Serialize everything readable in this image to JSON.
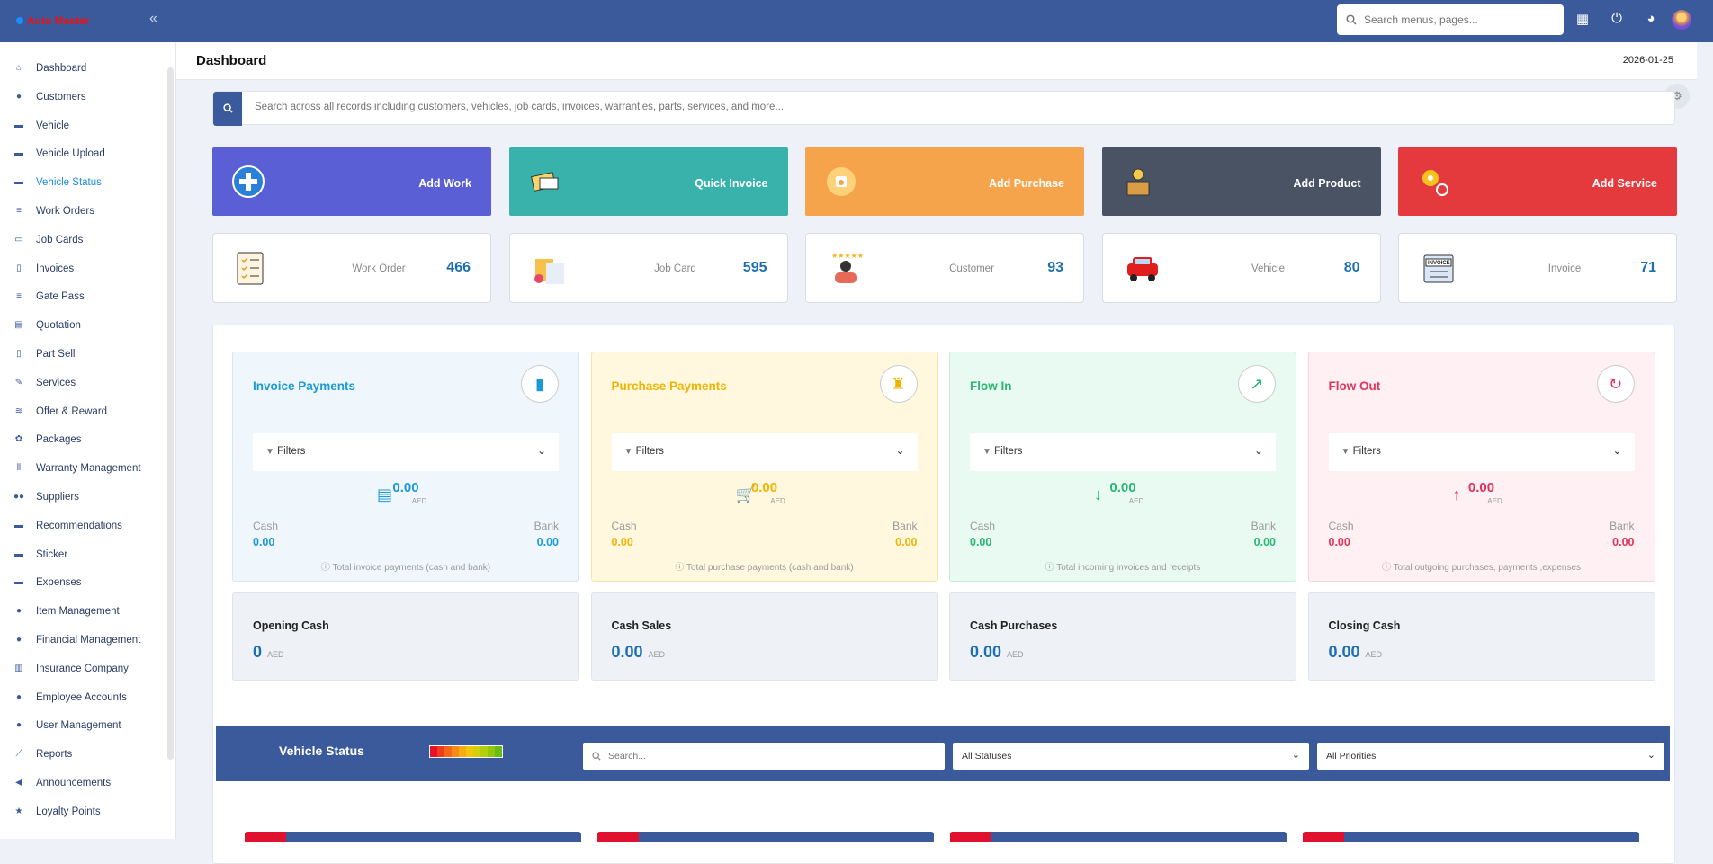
{
  "app": {
    "brand": "Auto Master"
  },
  "topbar": {
    "search_placeholder": "Search menus, pages..."
  },
  "sidebar": {
    "items": [
      {
        "label": "Dashboard",
        "icon": "home-icon"
      },
      {
        "label": "Customers",
        "icon": "user-icon"
      },
      {
        "label": "Vehicle",
        "icon": "car-icon"
      },
      {
        "label": "Vehicle Upload",
        "icon": "truck-icon"
      },
      {
        "label": "Vehicle Status",
        "icon": "car-icon",
        "active": true
      },
      {
        "label": "Work Orders",
        "icon": "list-icon"
      },
      {
        "label": "Job Cards",
        "icon": "card-icon"
      },
      {
        "label": "Invoices",
        "icon": "file-icon"
      },
      {
        "label": "Gate Pass",
        "icon": "list-icon"
      },
      {
        "label": "Quotation",
        "icon": "quote-icon"
      },
      {
        "label": "Part Sell",
        "icon": "bookmark-icon"
      },
      {
        "label": "Services",
        "icon": "wrench-icon"
      },
      {
        "label": "Offer & Reward",
        "icon": "layers-icon"
      },
      {
        "label": "Packages",
        "icon": "package-icon"
      },
      {
        "label": "Warranty Management",
        "icon": "barcode-icon"
      },
      {
        "label": "Suppliers",
        "icon": "users-icon"
      },
      {
        "label": "Recommendations",
        "icon": "box-icon"
      },
      {
        "label": "Sticker",
        "icon": "box-icon"
      },
      {
        "label": "Expenses",
        "icon": "box-icon"
      },
      {
        "label": "Item Management",
        "icon": "user-icon"
      },
      {
        "label": "Financial Management",
        "icon": "user-icon"
      },
      {
        "label": "Insurance Company",
        "icon": "building-icon"
      },
      {
        "label": "Employee Accounts",
        "icon": "user-icon"
      },
      {
        "label": "User Management",
        "icon": "user-icon"
      },
      {
        "label": "Reports",
        "icon": "chart-icon"
      },
      {
        "label": "Announcements",
        "icon": "megaphone-icon"
      },
      {
        "label": "Loyalty Points",
        "icon": "star-icon"
      }
    ]
  },
  "header": {
    "title": "Dashboard",
    "date": "2026-01-25"
  },
  "global_search": {
    "placeholder": "Search across all records including customers, vehicles, job cards, invoices, warranties, parts, services, and more..."
  },
  "actions": [
    {
      "label": "Add Work",
      "color": "#5a5fd6"
    },
    {
      "label": "Quick Invoice",
      "color": "#38b2aa"
    },
    {
      "label": "Add Purchase",
      "color": "#f5a44c"
    },
    {
      "label": "Add Product",
      "color": "#4a5364"
    },
    {
      "label": "Add Service",
      "color": "#e4393d"
    }
  ],
  "stats": [
    {
      "label": "Work Order",
      "value": "466"
    },
    {
      "label": "Job Card",
      "value": "595"
    },
    {
      "label": "Customer",
      "value": "93"
    },
    {
      "label": "Vehicle",
      "value": "80"
    },
    {
      "label": "Invoice",
      "value": "71"
    }
  ],
  "payments": [
    {
      "title": "Invoice Payments",
      "filters": "Filters",
      "amount": "0.00",
      "currency": "AED",
      "cash_label": "Cash",
      "cash": "0.00",
      "bank_label": "Bank",
      "bank": "0.00",
      "note": "Total invoice payments (cash and bank)",
      "color": "#1b9ad6",
      "bg": "#eff7fd",
      "border": "#d3e6f4"
    },
    {
      "title": "Purchase Payments",
      "filters": "Filters",
      "amount": "0.00",
      "currency": "AED",
      "cash_label": "Cash",
      "cash": "0.00",
      "bank_label": "Bank",
      "bank": "0.00",
      "note": "Total purchase payments (cash and bank)",
      "color": "#f0b400",
      "bg": "#fff8df",
      "border": "#f6e4a8"
    },
    {
      "title": "Flow In",
      "filters": "Filters",
      "amount": "0.00",
      "currency": "AED",
      "cash_label": "Cash",
      "cash": "0.00",
      "bank_label": "Bank",
      "bank": "0.00",
      "note": "Total incoming invoices and receipts",
      "color": "#2bb673",
      "bg": "#e9faf2",
      "border": "#c4ecd9"
    },
    {
      "title": "Flow Out",
      "filters": "Filters",
      "amount": "0.00",
      "currency": "AED",
      "cash_label": "Cash",
      "cash": "0.00",
      "bank_label": "Bank",
      "bank": "0.00",
      "note": "Total outgoing purchases, payments ,expenses",
      "color": "#e0335a",
      "bg": "#fff0f3",
      "border": "#f5d3dc"
    }
  ],
  "cash": [
    {
      "title": "Opening Cash",
      "value": "0",
      "unit": "AED"
    },
    {
      "title": "Cash Sales",
      "value": "0.00",
      "unit": "AED"
    },
    {
      "title": "Cash Purchases",
      "value": "0.00",
      "unit": "AED"
    },
    {
      "title": "Closing Cash",
      "value": "0.00",
      "unit": "AED"
    }
  ],
  "vehicle_status": {
    "title": "Vehicle Status",
    "search_placeholder": "Search...",
    "status_select": "All Statuses",
    "priority_select": "All Priorities"
  }
}
